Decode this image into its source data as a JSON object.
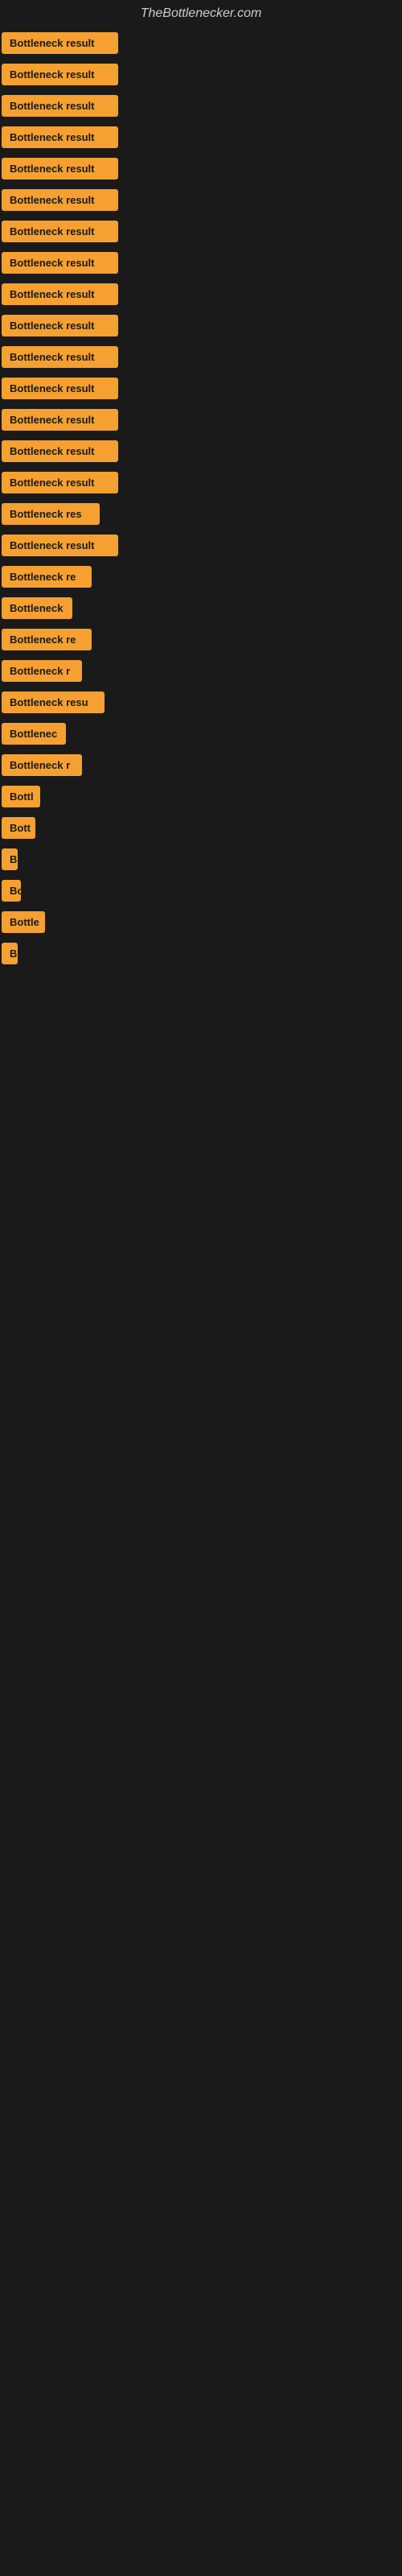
{
  "site": {
    "title": "TheBottlenecker.com"
  },
  "items": [
    {
      "label": "Bottleneck result",
      "width": 145
    },
    {
      "label": "Bottleneck result",
      "width": 145
    },
    {
      "label": "Bottleneck result",
      "width": 145
    },
    {
      "label": "Bottleneck result",
      "width": 145
    },
    {
      "label": "Bottleneck result",
      "width": 145
    },
    {
      "label": "Bottleneck result",
      "width": 145
    },
    {
      "label": "Bottleneck result",
      "width": 145
    },
    {
      "label": "Bottleneck result",
      "width": 145
    },
    {
      "label": "Bottleneck result",
      "width": 145
    },
    {
      "label": "Bottleneck result",
      "width": 145
    },
    {
      "label": "Bottleneck result",
      "width": 145
    },
    {
      "label": "Bottleneck result",
      "width": 145
    },
    {
      "label": "Bottleneck result",
      "width": 145
    },
    {
      "label": "Bottleneck result",
      "width": 145
    },
    {
      "label": "Bottleneck result",
      "width": 145
    },
    {
      "label": "Bottleneck res",
      "width": 122
    },
    {
      "label": "Bottleneck result",
      "width": 145
    },
    {
      "label": "Bottleneck re",
      "width": 112
    },
    {
      "label": "Bottleneck",
      "width": 88
    },
    {
      "label": "Bottleneck re",
      "width": 112
    },
    {
      "label": "Bottleneck r",
      "width": 100
    },
    {
      "label": "Bottleneck resu",
      "width": 128
    },
    {
      "label": "Bottlenec",
      "width": 80
    },
    {
      "label": "Bottleneck r",
      "width": 100
    },
    {
      "label": "Bottl",
      "width": 48
    },
    {
      "label": "Bott",
      "width": 42
    },
    {
      "label": "B",
      "width": 14
    },
    {
      "label": "Bo",
      "width": 24
    },
    {
      "label": "Bottle",
      "width": 54
    },
    {
      "label": "B",
      "width": 14
    }
  ]
}
